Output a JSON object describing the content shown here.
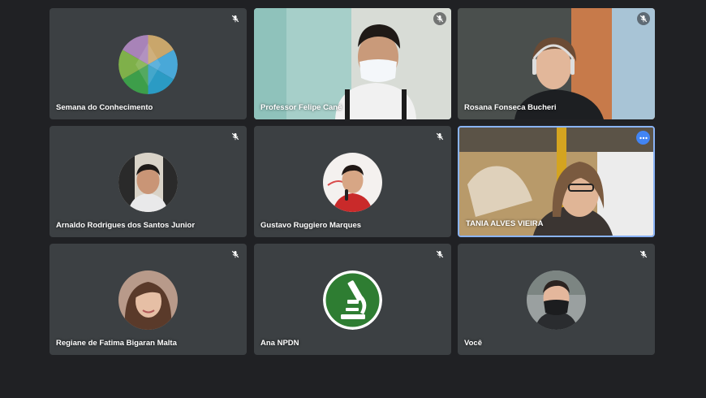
{
  "participants": [
    {
      "name": "Semana do Conhecimento",
      "muted": true,
      "type": "logo-avatar"
    },
    {
      "name": "Professor Felipe Cané",
      "muted": true,
      "type": "video"
    },
    {
      "name": "Rosana Fonseca Bucheri",
      "muted": true,
      "type": "video"
    },
    {
      "name": "Arnaldo Rodrigues dos Santos Junior",
      "muted": true,
      "type": "photo-avatar"
    },
    {
      "name": "Gustavo Ruggiero Marques",
      "muted": true,
      "type": "photo-avatar"
    },
    {
      "name": "TANIA ALVES VIEIRA",
      "muted": false,
      "type": "video",
      "active_speaker": true
    },
    {
      "name": "Regiane de Fatima Bigaran Malta",
      "muted": true,
      "type": "photo-avatar"
    },
    {
      "name": "Ana NPDN",
      "muted": true,
      "type": "logo-avatar"
    },
    {
      "name": "Você",
      "muted": true,
      "type": "photo-avatar"
    }
  ],
  "icons": {
    "mute": "mic-off-icon",
    "more": "more-options-icon"
  },
  "colors": {
    "background": "#202124",
    "tile": "#3c4043",
    "active_border": "#8ab4f8",
    "more_button": "#4285f4",
    "ana_logo": "#2e7d32"
  }
}
